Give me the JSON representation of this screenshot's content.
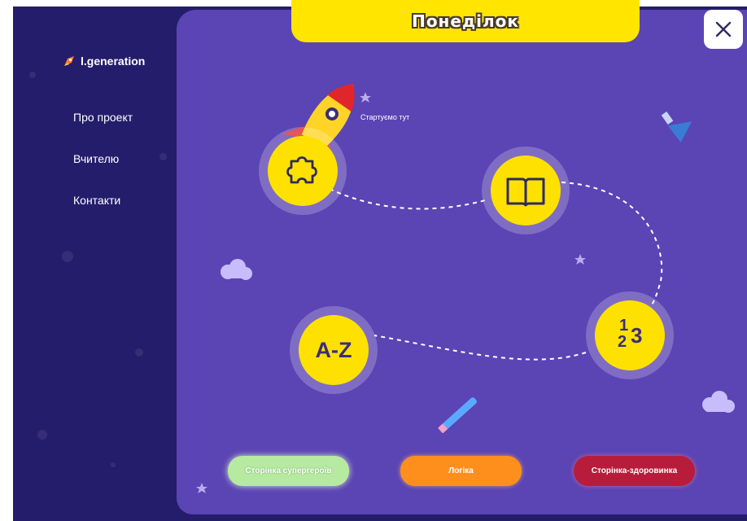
{
  "brand": {
    "name": "l.generation"
  },
  "nav": {
    "items": [
      {
        "label": "Про проект"
      },
      {
        "label": "Вчителю"
      },
      {
        "label": "Контакти"
      }
    ]
  },
  "header": {
    "title": "Понеділок"
  },
  "close": {
    "icon": "close-icon"
  },
  "map": {
    "start_label": "Стартуємо тут",
    "nodes": [
      {
        "name": "puzzle",
        "icon": "puzzle-icon"
      },
      {
        "name": "book",
        "icon": "book-icon"
      },
      {
        "name": "numbers",
        "icon": "numbers-icon",
        "text": [
          "1",
          "2",
          "3"
        ]
      },
      {
        "name": "alphabet",
        "icon": "alphabet-icon",
        "text": "A-Z"
      }
    ]
  },
  "footer": {
    "buttons": [
      {
        "label": "Сторінка супергероїв",
        "color": "#b7eaa1"
      },
      {
        "label": "Логіка",
        "color": "#ff8f1c"
      },
      {
        "label": "Сторінка-здоровинка",
        "color": "#b71c3a"
      }
    ]
  },
  "colors": {
    "sidebar": "#241d6b",
    "panel": "#5b44b4",
    "accent": "#ffe100"
  }
}
